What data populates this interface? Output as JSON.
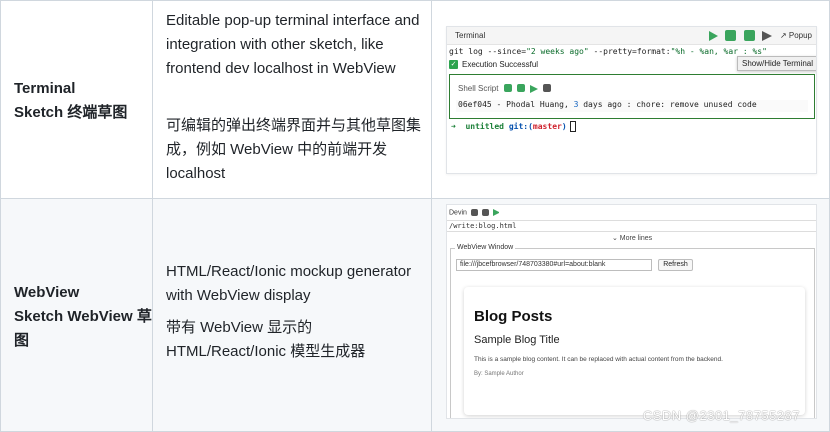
{
  "rows": [
    {
      "name_en": "Terminal",
      "name_rest": "Sketch 终端草图",
      "desc_en": "Editable pop-up terminal interface and integration with other sketch, like frontend dev localhost in WebView",
      "desc_zh": "可编辑的弹出终端界面并与其他草图集成，例如 WebView 中的前端开发 localhost"
    },
    {
      "name_en": "WebView",
      "name_rest": "Sketch WebView 草图",
      "desc_en": "HTML/React/Ionic mockup generator with WebView display",
      "desc_zh": "带有 WebView 显示的 HTML/React/Ionic 模型生成器"
    }
  ],
  "terminal": {
    "title": "Terminal",
    "popup": "↗ Popup",
    "cmd_pre": "git log --since=",
    "cmd_str1": "\"2 weeks ago\"",
    "cmd_mid": " --pretty=format:",
    "cmd_str2": "\"%h - %an, %ar : %s\"",
    "tooltip": "Show/Hide Terminal",
    "exec_text": "Execution Successful",
    "shell_title": "Shell Script",
    "log_pre": "06ef045 - Phodal Huang, ",
    "log_num": "3",
    "log_post": " days ago : chore: remove unused code",
    "prompt_arrow": "➜",
    "prompt_dir": "untitled",
    "prompt_git": "git:(",
    "prompt_branch": "master",
    "prompt_close": ")"
  },
  "webview": {
    "devin": "Devin",
    "url": "/write:blog.html",
    "more": "⌄ More lines",
    "legend": "WebView Window",
    "address": "file:///jbcefbrowser/748703380#url=about:blank",
    "refresh": "Refresh",
    "h1": "Blog Posts",
    "h2": "Sample Blog Title",
    "p": "This is a sample blog content. It can be replaced with actual content from the backend.",
    "by": "By: Sample Author"
  },
  "watermark": "CSDN @2301_78755287"
}
